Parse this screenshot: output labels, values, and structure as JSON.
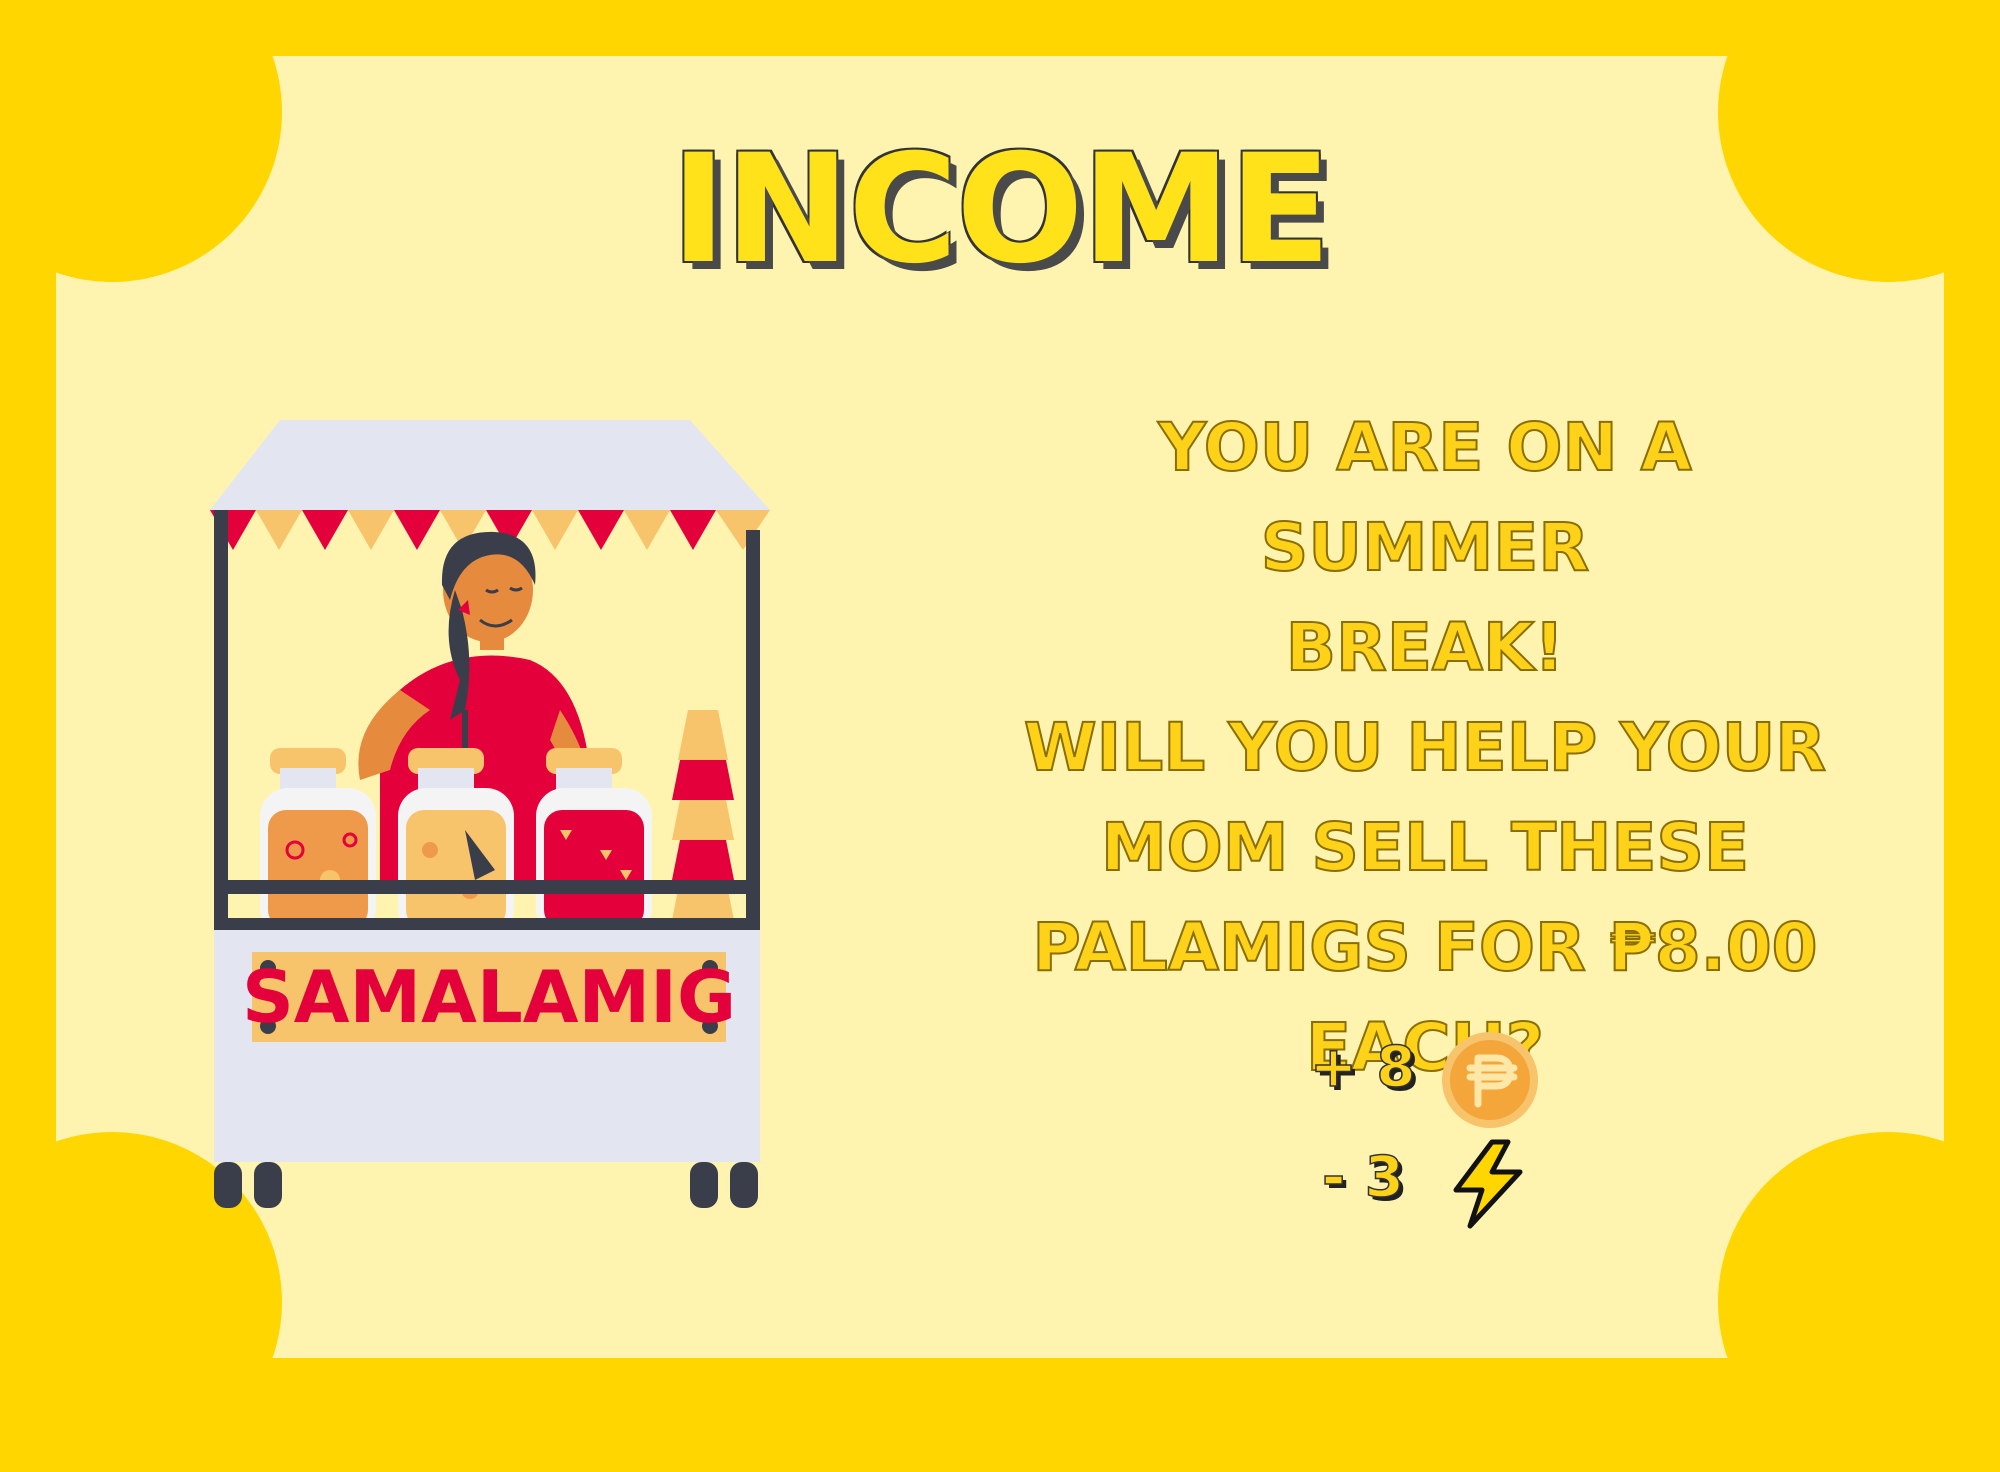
{
  "card": {
    "title": "INCOME",
    "description_lines": [
      "YOU ARE ON A SUMMER",
      "BREAK!",
      "WILL YOU HELP YOUR",
      "MOM SELL THESE",
      "PALAMIGS FOR ₱8.00",
      "EACH?"
    ]
  },
  "effects": {
    "coin": {
      "value": "+ 8",
      "icon": "peso-coin-icon"
    },
    "energy": {
      "value": "- 3",
      "icon": "lightning-bolt-icon"
    }
  },
  "illustration": {
    "sign_label": "SAMALAMIG"
  },
  "colors": {
    "border": "#FFD600",
    "card_bg": "#FFF3B0",
    "title_fill": "#FFE21A",
    "text_fill": "#FFD21A",
    "accent_red": "#E3003B",
    "accent_orange": "#F2A65A"
  }
}
